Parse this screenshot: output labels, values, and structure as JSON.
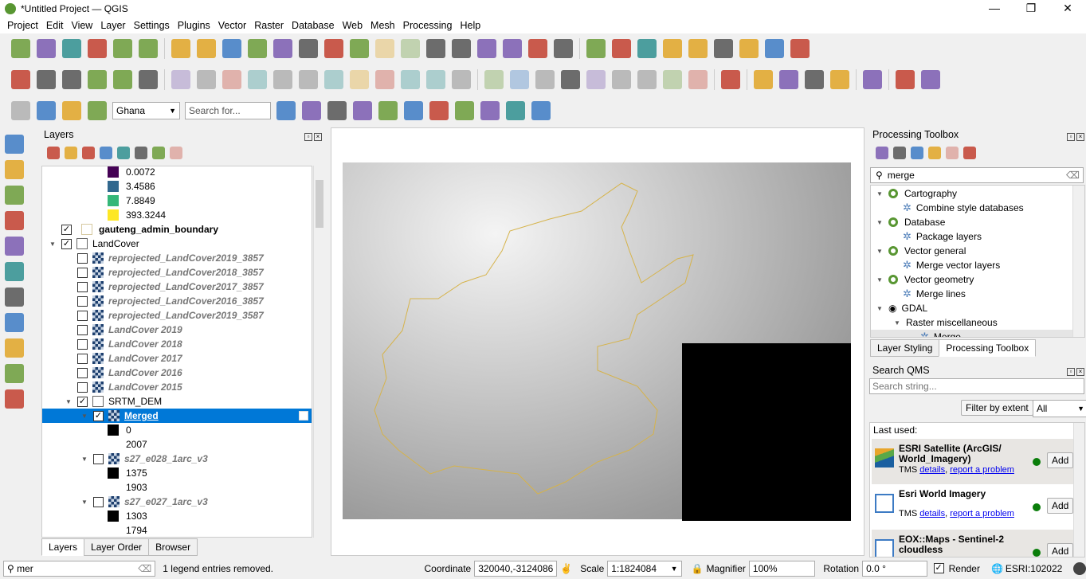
{
  "window": {
    "title": "*Untitled Project — QGIS",
    "minimize": "—",
    "maximize": "❐",
    "close": "✕"
  },
  "menu": [
    "Project",
    "Edit",
    "View",
    "Layer",
    "Settings",
    "Plugins",
    "Vector",
    "Raster",
    "Database",
    "Web",
    "Mesh",
    "Processing",
    "Help"
  ],
  "toolbar1": {
    "icons": [
      "new-project-icon",
      "open-project-icon",
      "save-project-icon",
      "new-print-layout-icon",
      "layout-manager-icon",
      "style-manager-icon",
      "|",
      "pan-icon",
      "pan-to-selection-icon",
      "zoom-in-icon",
      "zoom-out-icon",
      "zoom-full-icon",
      "zoom-to-selection-icon",
      "zoom-to-layer-icon",
      "zoom-native-icon",
      "zoom-last-icon",
      "zoom-next-icon",
      "new-map-view-icon",
      "new-3d-view-icon",
      "bookmark-icon",
      "show-bookmarks-icon",
      "temporal-controller-icon",
      "refresh-icon",
      "|",
      "identify-icon",
      "attribute-table-icon",
      "field-calculator-icon",
      "processing-toolbox-icon",
      "statistics-icon",
      "measure-icon",
      "map-tips-icon",
      "select-icon",
      "text-annotation-icon"
    ]
  },
  "toolbar2": {
    "icons": [
      "data-source-manager-icon",
      "new-geopackage-icon",
      "new-shapefile-icon",
      "digitize-icon",
      "new-temp-layer-icon",
      "new-virtual-layer-icon",
      "|",
      "current-edits-icon",
      "toggle-editing-icon",
      "save-edits-icon",
      "add-feature-icon",
      "vertex-tool-icon",
      "modify-attributes-icon",
      "delete-selected-icon",
      "cut-icon",
      "copy-icon",
      "paste-icon",
      "undo-icon",
      "redo-icon",
      "|",
      "label-icon",
      "label-pin-icon",
      "layer-labeling-icon",
      "layer-diagram-icon",
      "pin-labels-icon",
      "show-labels-icon",
      "move-label-icon",
      "rotate-label-icon",
      "change-label-icon",
      "|",
      "db-manager-icon",
      "|",
      "georeferencer-icon",
      "mapswipe-icon",
      "quickmapservices-icon",
      "qms-search-icon",
      "|",
      "help-icon",
      "|",
      "plugin-a-icon",
      "plugin-b-icon"
    ]
  },
  "toolbar3": {
    "country": "Ghana",
    "search_placeholder": "Search for...",
    "icons": [
      "select-features-icon",
      "deselect-icon",
      "select-by-value-icon",
      "select-location-icon",
      "geosearch-icon",
      "profile-tool-icon",
      "search-plugin-icon",
      "sld-icon",
      "python-console-icon",
      "plugin-fire-icon",
      "plugin-folder-icon",
      "layer-stack-icon",
      "globe-icon",
      "plugin-green-icon",
      "plugin-orange-icon"
    ]
  },
  "left_toolbar": [
    "add-vector-layer-icon",
    "add-raster-layer-icon",
    "add-mesh-layer-icon",
    "add-delimited-text-icon",
    "add-spatialite-icon",
    "add-postgis-icon",
    "add-wms-icon",
    "add-wfs-icon",
    "add-wcs-icon",
    "add-xyz-icon",
    "add-arcgis-icon"
  ],
  "layers_panel": {
    "title": "Layers",
    "tools": [
      "style-icon",
      "add-group-icon",
      "visibility-icon",
      "filter-icon",
      "expression-filter-icon",
      "expand-all-icon",
      "collapse-all-icon",
      "remove-layer-icon"
    ],
    "tree": [
      {
        "type": "legend",
        "label": "0.0072",
        "color": "#440154",
        "level": 2
      },
      {
        "type": "legend",
        "label": "3.4586",
        "color": "#31688e",
        "level": 2
      },
      {
        "type": "legend",
        "label": "7.8849",
        "color": "#35b779",
        "level": 2
      },
      {
        "type": "legend",
        "label": "393.3244",
        "color": "#fde725",
        "level": 2
      },
      {
        "type": "vector",
        "label": "gauteng_admin_boundary",
        "checked": true,
        "bold": true,
        "level": 0
      },
      {
        "type": "group",
        "label": "LandCover",
        "checked": true,
        "expanded": true,
        "level": 0
      },
      {
        "type": "raster",
        "label": "reprojected_LandCover2019_3857",
        "checked": false,
        "italic": true,
        "level": 1
      },
      {
        "type": "raster",
        "label": "reprojected_LandCover2018_3857",
        "checked": false,
        "italic": true,
        "level": 1
      },
      {
        "type": "raster",
        "label": "reprojected_LandCover2017_3857",
        "checked": false,
        "italic": true,
        "level": 1
      },
      {
        "type": "raster",
        "label": "reprojected_LandCover2016_3857",
        "checked": false,
        "italic": true,
        "level": 1
      },
      {
        "type": "raster",
        "label": "reprojected_LandCover2019_3587",
        "checked": false,
        "italic": true,
        "level": 1
      },
      {
        "type": "raster",
        "label": "LandCover 2019",
        "checked": false,
        "italic": true,
        "level": 1
      },
      {
        "type": "raster",
        "label": "LandCover 2018",
        "checked": false,
        "italic": true,
        "level": 1
      },
      {
        "type": "raster",
        "label": "LandCover 2017",
        "checked": false,
        "italic": true,
        "level": 1
      },
      {
        "type": "raster",
        "label": "LandCover 2016",
        "checked": false,
        "italic": true,
        "level": 1
      },
      {
        "type": "raster",
        "label": "LandCover 2015",
        "checked": false,
        "italic": true,
        "level": 1
      },
      {
        "type": "group",
        "label": "SRTM_DEM",
        "checked": true,
        "expanded": true,
        "level": 1
      },
      {
        "type": "raster",
        "label": "Merged",
        "checked": true,
        "selected": true,
        "expanded": true,
        "level": 2
      },
      {
        "type": "legend",
        "label": "0",
        "color": "#000000",
        "level": 3
      },
      {
        "type": "legend",
        "label": "2007",
        "color": "#ffffff",
        "level": 3
      },
      {
        "type": "raster",
        "label": "s27_e028_1arc_v3",
        "checked": false,
        "italic": true,
        "expanded": true,
        "level": 2
      },
      {
        "type": "legend",
        "label": "1375",
        "color": "#000000",
        "level": 3
      },
      {
        "type": "legend",
        "label": "1903",
        "color": "#ffffff",
        "level": 3
      },
      {
        "type": "raster",
        "label": "s27_e027_1arc_v3",
        "checked": false,
        "italic": true,
        "expanded": true,
        "level": 2
      },
      {
        "type": "legend",
        "label": "1303",
        "color": "#000000",
        "level": 3
      },
      {
        "type": "legend",
        "label": "1794",
        "color": "#ffffff",
        "level": 3
      }
    ],
    "tabs": [
      "Layers",
      "Layer Order",
      "Browser"
    ]
  },
  "processing": {
    "title": "Processing Toolbox",
    "tools": [
      "models-icon",
      "python-scripts-icon",
      "history-icon",
      "results-viewer-icon",
      "edit-features-in-place-icon",
      "options-icon"
    ],
    "search": "merge",
    "tree": [
      {
        "kind": "provider",
        "label": "Cartography"
      },
      {
        "kind": "alg",
        "label": "Combine style databases"
      },
      {
        "kind": "provider",
        "label": "Database"
      },
      {
        "kind": "alg",
        "label": "Package layers"
      },
      {
        "kind": "provider",
        "label": "Vector general"
      },
      {
        "kind": "alg",
        "label": "Merge vector layers"
      },
      {
        "kind": "provider",
        "label": "Vector geometry"
      },
      {
        "kind": "alg",
        "label": "Merge lines"
      },
      {
        "kind": "gdal",
        "label": "GDAL"
      },
      {
        "kind": "sub",
        "label": "Raster miscellaneous"
      },
      {
        "kind": "alg2",
        "label": "Merge"
      }
    ],
    "tabs": [
      "Layer Styling",
      "Processing Toolbox"
    ]
  },
  "qms": {
    "title": "Search QMS",
    "placeholder": "Search string...",
    "filter_button": "Filter by extent",
    "filter_value": "All",
    "last_used": "Last used:",
    "items": [
      {
        "name": "ESRI Satellite (ArcGIS/ World_Imagery)",
        "type": "TMS",
        "details": "details",
        "report": "report a problem",
        "add": "Add",
        "status": "#0a7d0a"
      },
      {
        "name": "Esri World Imagery",
        "type": "TMS",
        "details": "details",
        "report": "report a problem",
        "add": "Add",
        "status": "#0a7d0a"
      },
      {
        "name": "EOX::Maps - Sentinel-2 cloudless",
        "add": "Add",
        "status": "#0a7d0a"
      }
    ]
  },
  "status": {
    "locator_value": "mer",
    "message": "1 legend entries removed.",
    "coordinate_label": "Coordinate",
    "coordinate": "320040,-3124086",
    "scale_label": "Scale",
    "scale": "1:1824084",
    "magnifier_label": "Magnifier",
    "magnifier": "100%",
    "rotation_label": "Rotation",
    "rotation": "0.0 °",
    "render_label": "Render",
    "render_checked": true,
    "crs": "ESRI:102022"
  }
}
